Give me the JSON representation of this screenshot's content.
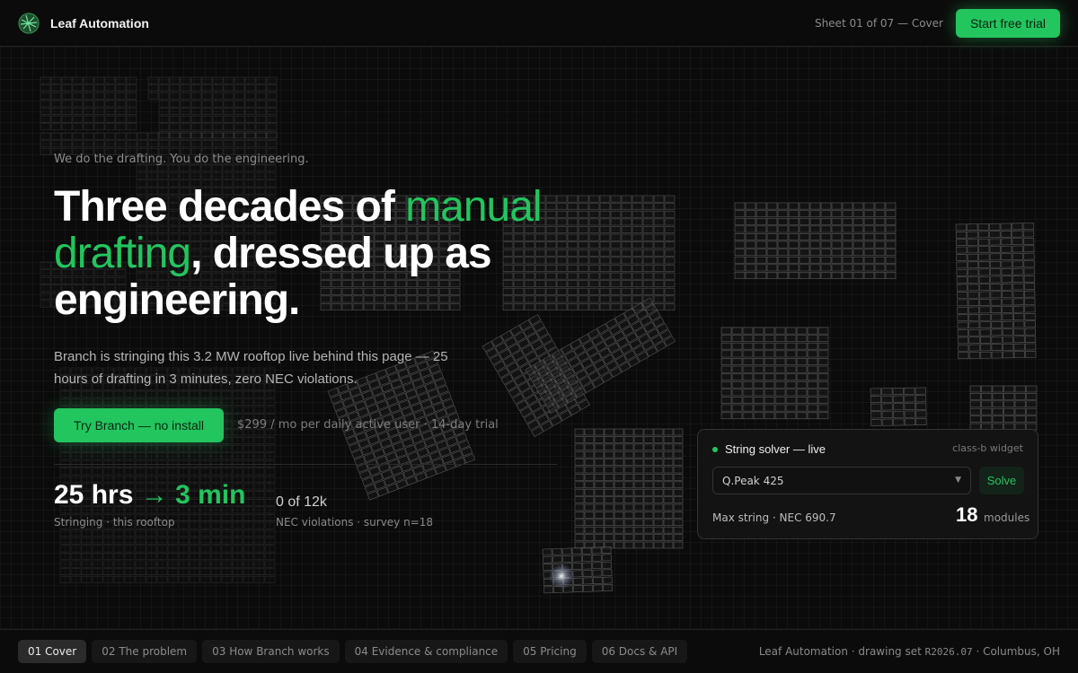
{
  "header": {
    "brand": "Leaf Automation",
    "sheet": "Sheet 01 of 07 — Cover",
    "cta_label": "Start free trial"
  },
  "hero": {
    "eyebrow": "We do the drafting. You do the engineering.",
    "headline_1": "Three decades of ",
    "headline_accent": "manual drafting",
    "headline_2": ", dressed up as engineering.",
    "lede": "Branch is stringing this 3.2 MW rooftop live behind this page — 25 hours of drafting in 3 minutes, zero NEC violations.",
    "primary_cta": "Try Branch — no install",
    "pricing_note": "$299 / mo per daily active user · 14-day trial"
  },
  "stats": {
    "from": "25 hrs",
    "arrow": "→",
    "to": "3 min",
    "caption": "Stringing · this rooftop",
    "nec_value": "0 of 12k",
    "nec_caption": "NEC violations · survey n=18"
  },
  "widget": {
    "title": "String solver — live",
    "tag": "class-b widget",
    "module": "Q.Peak 425",
    "solve_label": "Solve",
    "max_label": "Max string · NEC 690.7",
    "count": "18",
    "count_unit": "modules"
  },
  "nav": {
    "tabs": [
      {
        "label": "01 Cover",
        "active": true
      },
      {
        "label": "02 The problem"
      },
      {
        "label": "03 How Branch works"
      },
      {
        "label": "04 Evidence & compliance"
      },
      {
        "label": "05 Pricing"
      },
      {
        "label": "06 Docs & API"
      }
    ]
  },
  "footer": {
    "prefix": "Leaf Automation · drawing set ",
    "set_id": "R2026.07",
    "suffix": " · Columbus, OH"
  },
  "icons": {
    "logo": "leaf-globe-logo",
    "status": "live-dot-icon",
    "dropdown": "chevron-down-icon"
  },
  "colors": {
    "accent": "#22c55e",
    "background": "#0b0b0b",
    "panel_stroke": "#6f6f6f"
  }
}
